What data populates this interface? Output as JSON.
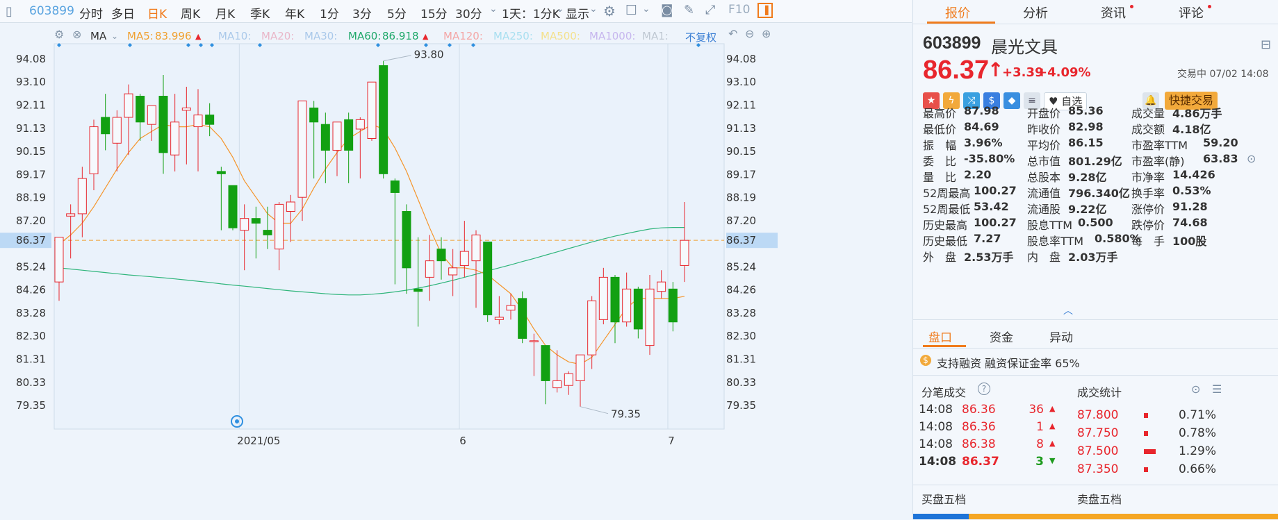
{
  "toolbar": {
    "code": "603899",
    "periods": [
      "分时",
      "多日",
      "日K",
      "周K",
      "月K",
      "季K",
      "年K",
      "1分",
      "3分",
      "5分",
      "15分",
      "30分"
    ],
    "active_period": "日K",
    "interval": "1天：1分K",
    "display": "显示"
  },
  "ma_bar": {
    "label": "MA",
    "items": [
      {
        "label": "MA5:",
        "value": "83.996",
        "color": "#f0a030",
        "arrow": "▲"
      },
      {
        "label": "MA10:",
        "value": "",
        "color": "#aac9ea",
        "arrow": ""
      },
      {
        "label": "MA20:",
        "value": "",
        "color": "#e9b6c8",
        "arrow": ""
      },
      {
        "label": "MA30:",
        "value": "",
        "color": "#aac9ea",
        "arrow": ""
      },
      {
        "label": "MA60:",
        "value": "86.918",
        "color": "#1fa86a",
        "arrow": "▲"
      },
      {
        "label": "MA120:",
        "value": "",
        "color": "#f4a6a6",
        "arrow": ""
      },
      {
        "label": "MA250:",
        "value": "",
        "color": "#a8dff0",
        "arrow": ""
      },
      {
        "label": "MA500:",
        "value": "",
        "color": "#f4e18c",
        "arrow": ""
      },
      {
        "label": "MA1000:",
        "value": "",
        "color": "#c6b6ee",
        "arrow": ""
      },
      {
        "label": "MA1:",
        "value": "",
        "color": "#bfc8d2",
        "arrow": ""
      }
    ],
    "adjust": "不复权"
  },
  "chart_data": {
    "type": "candlestick",
    "y_ticks": [
      "94.08",
      "93.10",
      "92.11",
      "91.13",
      "90.15",
      "89.17",
      "88.19",
      "87.20",
      "86.37",
      "85.24",
      "84.26",
      "83.28",
      "82.30",
      "81.31",
      "80.33",
      "79.35"
    ],
    "ylim": [
      79.35,
      94.08
    ],
    "current_price_label": "86.37",
    "x_labels": [
      "2021/05",
      "6",
      "7"
    ],
    "high_annotation": "93.80",
    "low_annotation": "79.35",
    "candles": [
      {
        "o": 84.6,
        "h": 86.5,
        "l": 83.8,
        "c": 86.5
      },
      {
        "o": 87.4,
        "h": 87.9,
        "l": 85.6,
        "c": 87.5
      },
      {
        "o": 87.5,
        "h": 89.5,
        "l": 86.5,
        "c": 89.0
      },
      {
        "o": 89.2,
        "h": 91.5,
        "l": 88.5,
        "c": 91.2
      },
      {
        "o": 91.6,
        "h": 92.6,
        "l": 90.2,
        "c": 90.9
      },
      {
        "o": 90.5,
        "h": 91.9,
        "l": 89.3,
        "c": 91.6
      },
      {
        "o": 91.6,
        "h": 93.0,
        "l": 90.0,
        "c": 92.6
      },
      {
        "o": 92.5,
        "h": 92.6,
        "l": 90.6,
        "c": 91.4
      },
      {
        "o": 91.3,
        "h": 92.1,
        "l": 90.6,
        "c": 92.1
      },
      {
        "o": 92.5,
        "h": 93.4,
        "l": 89.2,
        "c": 90.1
      },
      {
        "o": 90.0,
        "h": 92.6,
        "l": 89.3,
        "c": 91.4
      },
      {
        "o": 91.9,
        "h": 92.9,
        "l": 89.6,
        "c": 92.0
      },
      {
        "o": 91.2,
        "h": 92.8,
        "l": 89.3,
        "c": 91.7
      },
      {
        "o": 91.7,
        "h": 92.2,
        "l": 90.8,
        "c": 91.3
      },
      {
        "o": 89.3,
        "h": 89.5,
        "l": 86.8,
        "c": 89.2
      },
      {
        "o": 88.7,
        "h": 88.7,
        "l": 86.8,
        "c": 86.9
      },
      {
        "o": 86.8,
        "h": 87.9,
        "l": 85.1,
        "c": 87.3
      },
      {
        "o": 87.3,
        "h": 87.8,
        "l": 85.6,
        "c": 87.1
      },
      {
        "o": 86.8,
        "h": 87.8,
        "l": 86.0,
        "c": 86.6
      },
      {
        "o": 86.0,
        "h": 88.0,
        "l": 85.1,
        "c": 87.9
      },
      {
        "o": 87.6,
        "h": 88.3,
        "l": 86.3,
        "c": 88.0
      },
      {
        "o": 88.2,
        "h": 92.3,
        "l": 87.2,
        "c": 92.3
      },
      {
        "o": 92.0,
        "h": 92.3,
        "l": 89.0,
        "c": 91.4
      },
      {
        "o": 91.3,
        "h": 91.8,
        "l": 88.8,
        "c": 90.2
      },
      {
        "o": 90.2,
        "h": 91.4,
        "l": 89.1,
        "c": 91.4
      },
      {
        "o": 91.5,
        "h": 91.8,
        "l": 88.8,
        "c": 90.2
      },
      {
        "o": 91.1,
        "h": 91.6,
        "l": 89.0,
        "c": 91.5
      },
      {
        "o": 90.7,
        "h": 93.1,
        "l": 90.6,
        "c": 93.1
      },
      {
        "o": 93.8,
        "h": 94.0,
        "l": 89.0,
        "c": 89.2
      },
      {
        "o": 88.9,
        "h": 89.0,
        "l": 84.5,
        "c": 88.4
      },
      {
        "o": 87.6,
        "h": 87.9,
        "l": 84.1,
        "c": 85.2
      },
      {
        "o": 84.3,
        "h": 86.5,
        "l": 82.7,
        "c": 84.2
      },
      {
        "o": 84.8,
        "h": 86.6,
        "l": 83.8,
        "c": 85.5
      },
      {
        "o": 86.0,
        "h": 86.5,
        "l": 84.7,
        "c": 85.5
      },
      {
        "o": 84.9,
        "h": 86.0,
        "l": 84.0,
        "c": 85.2
      },
      {
        "o": 85.3,
        "h": 87.2,
        "l": 84.8,
        "c": 85.9
      },
      {
        "o": 85.5,
        "h": 86.8,
        "l": 83.5,
        "c": 86.6
      },
      {
        "o": 86.3,
        "h": 86.3,
        "l": 82.9,
        "c": 83.2
      },
      {
        "o": 83.0,
        "h": 84.0,
        "l": 82.8,
        "c": 83.1
      },
      {
        "o": 83.4,
        "h": 84.1,
        "l": 83.0,
        "c": 83.6
      },
      {
        "o": 83.9,
        "h": 84.2,
        "l": 82.0,
        "c": 82.2
      },
      {
        "o": 82.1,
        "h": 82.4,
        "l": 80.6,
        "c": 82.1
      },
      {
        "o": 81.9,
        "h": 81.9,
        "l": 79.4,
        "c": 80.4
      },
      {
        "o": 80.1,
        "h": 81.7,
        "l": 79.9,
        "c": 80.4
      },
      {
        "o": 80.2,
        "h": 80.8,
        "l": 79.8,
        "c": 80.7
      },
      {
        "o": 80.4,
        "h": 81.5,
        "l": 79.3,
        "c": 81.5
      },
      {
        "o": 81.5,
        "h": 84.0,
        "l": 80.9,
        "c": 83.8
      },
      {
        "o": 83.0,
        "h": 85.2,
        "l": 82.8,
        "c": 84.8
      },
      {
        "o": 84.8,
        "h": 84.9,
        "l": 82.0,
        "c": 82.9
      },
      {
        "o": 82.9,
        "h": 85.0,
        "l": 82.7,
        "c": 84.3
      },
      {
        "o": 84.3,
        "h": 84.4,
        "l": 82.2,
        "c": 82.6
      },
      {
        "o": 81.9,
        "h": 84.9,
        "l": 81.5,
        "c": 84.3
      },
      {
        "o": 84.2,
        "h": 85.1,
        "l": 83.9,
        "c": 84.6
      },
      {
        "o": 84.3,
        "h": 84.6,
        "l": 82.5,
        "c": 82.9
      },
      {
        "o": 85.3,
        "h": 88.0,
        "l": 84.6,
        "c": 86.37
      }
    ],
    "ma5": [
      86.2,
      86.6,
      87.1,
      87.8,
      88.6,
      89.4,
      90.1,
      90.7,
      91.0,
      91.3,
      91.2,
      91.2,
      91.3,
      91.2,
      90.7,
      89.9,
      88.9,
      88.2,
      87.5,
      87.1,
      87.1,
      87.7,
      88.6,
      89.4,
      90.1,
      90.7,
      91.0,
      91.3,
      91.1,
      90.3,
      89.3,
      88.1,
      86.9,
      85.8,
      85.2,
      85.2,
      85.1,
      84.9,
      84.5,
      84.1,
      83.4,
      82.6,
      81.9,
      81.5,
      81.2,
      81.1,
      81.4,
      82.1,
      82.8,
      83.5,
      83.9,
      83.9,
      83.9,
      83.9,
      83.99
    ],
    "ma60": [
      85.2,
      85.15,
      85.1,
      85.05,
      85.0,
      84.95,
      84.9,
      84.86,
      84.82,
      84.78,
      84.73,
      84.68,
      84.63,
      84.58,
      84.52,
      84.47,
      84.42,
      84.37,
      84.32,
      84.27,
      84.22,
      84.18,
      84.14,
      84.1,
      84.07,
      84.05,
      84.05,
      84.08,
      84.12,
      84.18,
      84.25,
      84.34,
      84.44,
      84.55,
      84.67,
      84.8,
      84.93,
      85.07,
      85.2,
      85.33,
      85.47,
      85.6,
      85.74,
      85.88,
      86.02,
      86.16,
      86.3,
      86.43,
      86.55,
      86.66,
      86.76,
      86.85,
      86.9,
      86.92,
      86.918
    ]
  },
  "panel": {
    "tabs": [
      "报价",
      "分析",
      "资讯",
      "评论"
    ],
    "active_tab": "报价",
    "code": "603899",
    "name": "晨光文具",
    "price": "86.37",
    "change": "+3.39",
    "change_pct": "+4.09%",
    "status": "交易中 07/02 14:08",
    "watch_label": "自选",
    "trade_label": "快捷交易",
    "quotes_col1": [
      {
        "label": "最高价",
        "value": "87.98",
        "cls": "red"
      },
      {
        "label": "最低价",
        "value": "84.69",
        "cls": "red"
      },
      {
        "label": "振　幅",
        "value": "3.96%",
        "cls": ""
      },
      {
        "label": "委　比",
        "value": "-35.80%",
        "cls": ""
      },
      {
        "label": "量　比",
        "value": "2.20",
        "cls": ""
      },
      {
        "label": "52周最高",
        "value": "100.27",
        "cls": "red"
      },
      {
        "label": "52周最低",
        "value": "53.42",
        "cls": "green"
      },
      {
        "label": "历史最高",
        "value": "100.27",
        "cls": "red"
      },
      {
        "label": "历史最低",
        "value": "7.27",
        "cls": "green"
      },
      {
        "label": "外　盘",
        "value": "2.53万手",
        "cls": "red"
      }
    ],
    "quotes_col2": [
      {
        "label": "开盘价",
        "value": "85.36",
        "cls": "red"
      },
      {
        "label": "昨收价",
        "value": "82.98",
        "cls": ""
      },
      {
        "label": "平均价",
        "value": "86.15",
        "cls": "red"
      },
      {
        "label": "总市值",
        "value": "801.29亿",
        "cls": ""
      },
      {
        "label": "总股本",
        "value": "9.28亿",
        "cls": ""
      },
      {
        "label": "流通值",
        "value": "796.340亿",
        "cls": ""
      },
      {
        "label": "流通股",
        "value": "9.22亿",
        "cls": ""
      },
      {
        "label": "股息TTM",
        "value": "0.500",
        "cls": ""
      },
      {
        "label": "股息率TTM",
        "value": "0.580%",
        "cls": ""
      },
      {
        "label": "内　盘",
        "value": "2.03万手",
        "cls": "green"
      }
    ],
    "quotes_col3": [
      {
        "label": "成交量",
        "value": "4.86万手",
        "cls": ""
      },
      {
        "label": "成交额",
        "value": "4.18亿",
        "cls": ""
      },
      {
        "label": "市盈率TTM",
        "value": "59.20",
        "cls": ""
      },
      {
        "label": "市盈率(静)",
        "value": "63.83",
        "cls": ""
      },
      {
        "label": "市净率",
        "value": "14.426",
        "cls": ""
      },
      {
        "label": "换手率",
        "value": "0.53%",
        "cls": ""
      },
      {
        "label": "涨停价",
        "value": "91.28",
        "cls": "red"
      },
      {
        "label": "跌停价",
        "value": "74.68",
        "cls": "green"
      },
      {
        "label": "每　手",
        "value": "100股",
        "cls": ""
      }
    ],
    "subtabs": [
      "盘口",
      "资金",
      "异动"
    ],
    "margin_note": "支持融资 融资保证金率 65%",
    "ticks_title": "分笔成交",
    "stats_title": "成交统计",
    "ticks": [
      {
        "time": "14:08",
        "price": "86.36",
        "vol": "36",
        "dir": "up"
      },
      {
        "time": "14:08",
        "price": "86.36",
        "vol": "1",
        "dir": "up"
      },
      {
        "time": "14:08",
        "price": "86.38",
        "vol": "8",
        "dir": "up"
      },
      {
        "time": "14:08",
        "price": "86.37",
        "vol": "3",
        "dir": "down"
      }
    ],
    "stats": [
      {
        "price": "87.800",
        "pct": "0.71%",
        "frac": 0.15
      },
      {
        "price": "87.750",
        "pct": "0.78%",
        "frac": 0.17
      },
      {
        "price": "87.500",
        "pct": "1.29%",
        "frac": 0.55
      },
      {
        "price": "87.350",
        "pct": "0.66%",
        "frac": 0.14
      }
    ],
    "buy5_title": "买盘五档",
    "sell5_title": "卖盘五档"
  }
}
